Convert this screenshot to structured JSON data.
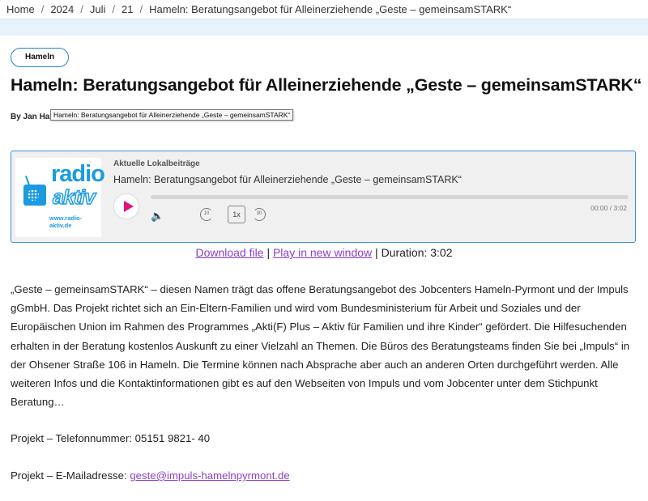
{
  "breadcrumb": {
    "items": [
      "Home",
      "2024",
      "Juli",
      "21",
      "Hameln: Beratungsangebot für Alleinerziehende „Geste – gemeinsamSTARK“"
    ],
    "separator": "/"
  },
  "article": {
    "category_tag": "Hameln",
    "title": "Hameln: Beratungsangebot für Alleinerziehende „Geste – gemeinsamSTARK“",
    "byline": "By Jan Har",
    "tooltip": "Hameln: Beratungsangebot für Alleinerziehende „Geste – gemeinsamSTARK“"
  },
  "player": {
    "logo_line1": "radio",
    "logo_line2": "aktiv",
    "logo_url": "www.radio-aktiv.de",
    "category": "Aktuelle Lokalbeiträge",
    "episode_title": "Hameln: Beratungsangebot für Alleinerziehende „Geste – gemeinsamSTARK“",
    "time": "00:00 / 3:02",
    "speed": "1x",
    "rewind_label": "10",
    "forward_label": "30",
    "progress": 0,
    "colors": {
      "play": "#e6117d",
      "brand": "#1a9be0",
      "border": "#3b8fd5"
    },
    "icons": [
      "play-icon",
      "volume-icon",
      "rewind-10-icon",
      "forward-30-icon"
    ]
  },
  "downloads": {
    "download": "Download file",
    "sep1": "|",
    "play_new": "Play in new window",
    "sep2": "|",
    "duration": "Duration: 3:02"
  },
  "body": {
    "paragraph": "„Geste – gemeinsamSTARK“ – diesen Namen trägt das offene Beratungsangebot des Jobcenters Hameln-Pyrmont und der Impuls gGmbH. Das Projekt richtet sich an Ein-Eltern-Familien und wird vom Bundesministerium für Arbeit und Soziales und der Europäischen Union im Rahmen des Programmes „Akti(F) Plus – Aktiv für Familien und ihre Kinder“ gefördert. Die Hilfesuchenden erhalten in der Beratung kostenlos Auskunft zu einer Vielzahl an Themen. Die Büros des Beratungsteams finden Sie bei „Impuls“ in der Ohsener Straße 106 in Hameln. Die Termine können nach Absprache aber auch an anderen Orten durchgeführt werden. Alle weiteren Infos und die Kontaktinformationen gibt es auf den Webseiten von Impuls und vom Jobcenter unter dem Stichpunkt Beratung…",
    "phone_line": "Projekt – Telefonnummer: 05151 9821- 40",
    "email_label": "Projekt – E-Mailadresse:",
    "email": "geste@impuls-hamelnpyrmont.de"
  }
}
